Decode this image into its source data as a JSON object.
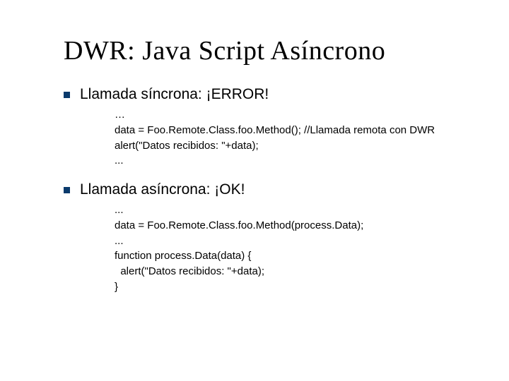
{
  "title": "DWR: Java Script Asíncrono",
  "bullets": [
    {
      "heading": "Llamada síncrona: ¡ERROR!",
      "code": "…\ndata = Foo.Remote.Class.foo.Method(); //Llamada remota con DWR\nalert(\"Datos recibidos: \"+data);\n..."
    },
    {
      "heading": "Llamada asíncrona: ¡OK!",
      "code": "...\ndata = Foo.Remote.Class.foo.Method(process.Data);\n...\nfunction process.Data(data) {\n  alert(\"Datos recibidos: \"+data);\n}"
    }
  ]
}
